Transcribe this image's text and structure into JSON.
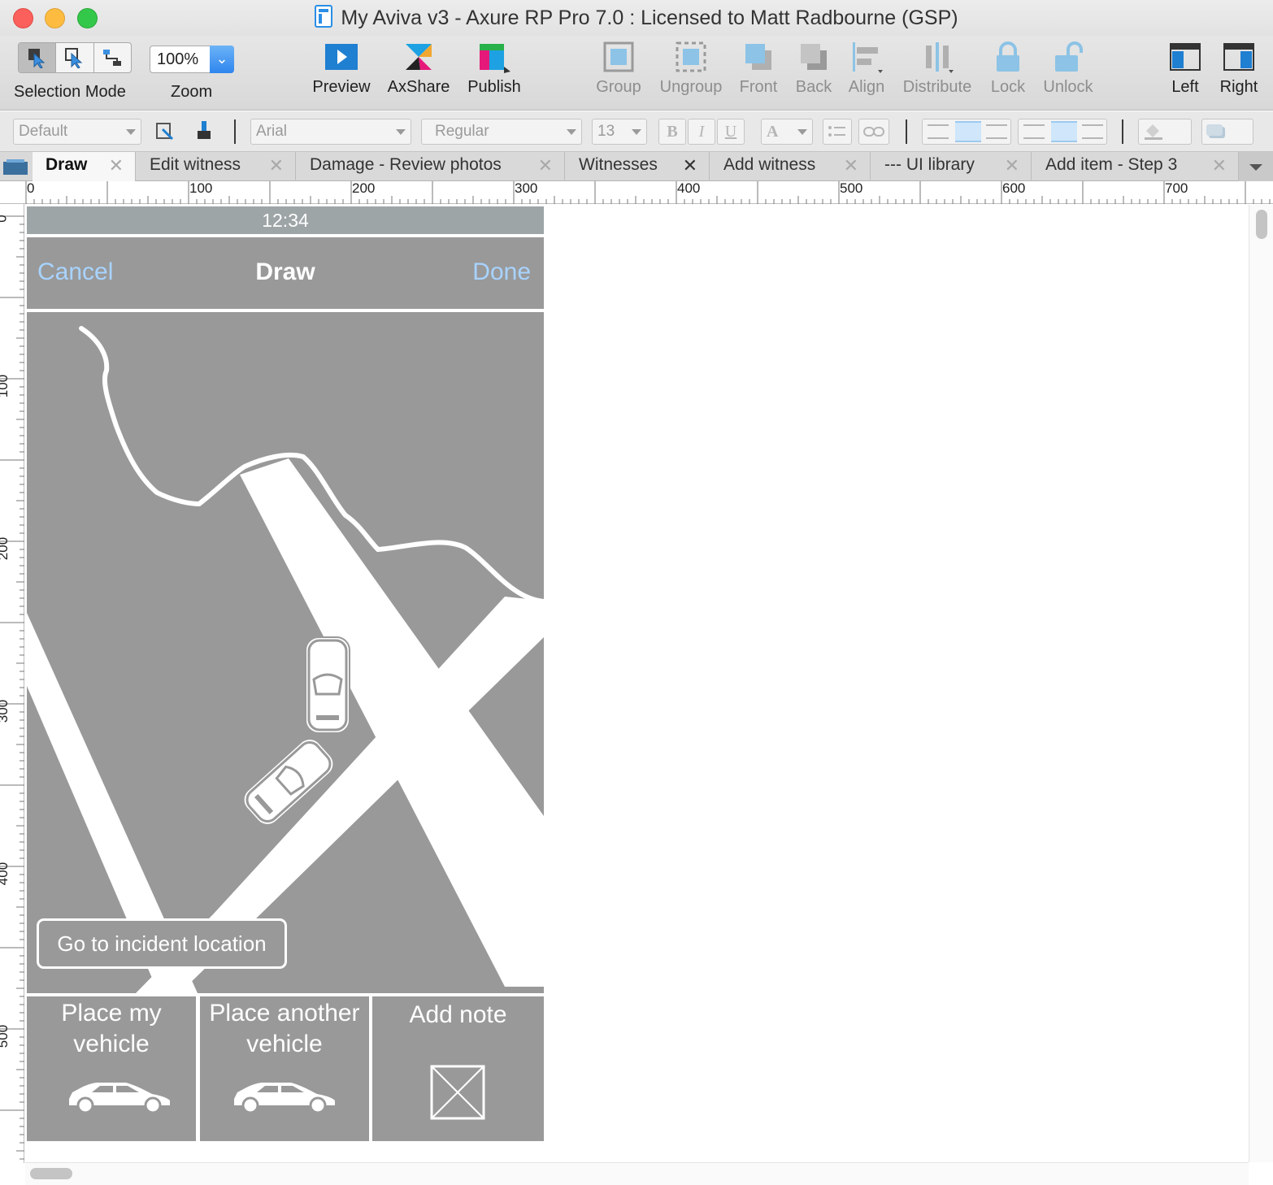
{
  "window": {
    "title": "My Aviva v3 - Axure RP Pro 7.0 : Licensed to Matt Radbourne (GSP)"
  },
  "toolbar": {
    "selection_mode_label": "Selection Mode",
    "zoom_value": "100%",
    "zoom_label": "Zoom",
    "preview_label": "Preview",
    "axshare_label": "AxShare",
    "publish_label": "Publish",
    "group_label": "Group",
    "ungroup_label": "Ungroup",
    "front_label": "Front",
    "back_label": "Back",
    "align_label": "Align",
    "distribute_label": "Distribute",
    "lock_label": "Lock",
    "unlock_label": "Unlock",
    "left_label": "Left",
    "right_label": "Right"
  },
  "formatbar": {
    "style_value": "Default",
    "font_value": "Arial",
    "weight_value": "Regular",
    "size_value": "13",
    "bold": "B",
    "italic": "I",
    "underline": "U",
    "font_color": "A"
  },
  "tabs": [
    {
      "label": "Draw",
      "active": true
    },
    {
      "label": "Edit witness"
    },
    {
      "label": "Damage - Review photos"
    },
    {
      "label": "Witnesses"
    },
    {
      "label": "Add witness"
    },
    {
      "label": "--- UI library"
    },
    {
      "label": "Add item - Step 3"
    }
  ],
  "tab_close": "✕",
  "ruler": {
    "h": [
      "0",
      "100",
      "200",
      "300",
      "400",
      "500",
      "600",
      "700"
    ],
    "v": [
      "0",
      "100",
      "200",
      "300",
      "400",
      "500"
    ]
  },
  "mockup": {
    "status_time": "12:34",
    "nav": {
      "cancel": "Cancel",
      "title": "Draw",
      "done": "Done"
    },
    "goto_button": "Go to incident location",
    "bottom": {
      "my_vehicle": [
        "Place my",
        "vehicle"
      ],
      "another_vehicle": [
        "Place another",
        "vehicle"
      ],
      "add_note": "Add note"
    }
  },
  "colors": {
    "mock_gray": "#999999",
    "status_gray": "#9ea5a7",
    "link_blue": "#a8d3ff",
    "accent_blue": "#2f86ee"
  }
}
